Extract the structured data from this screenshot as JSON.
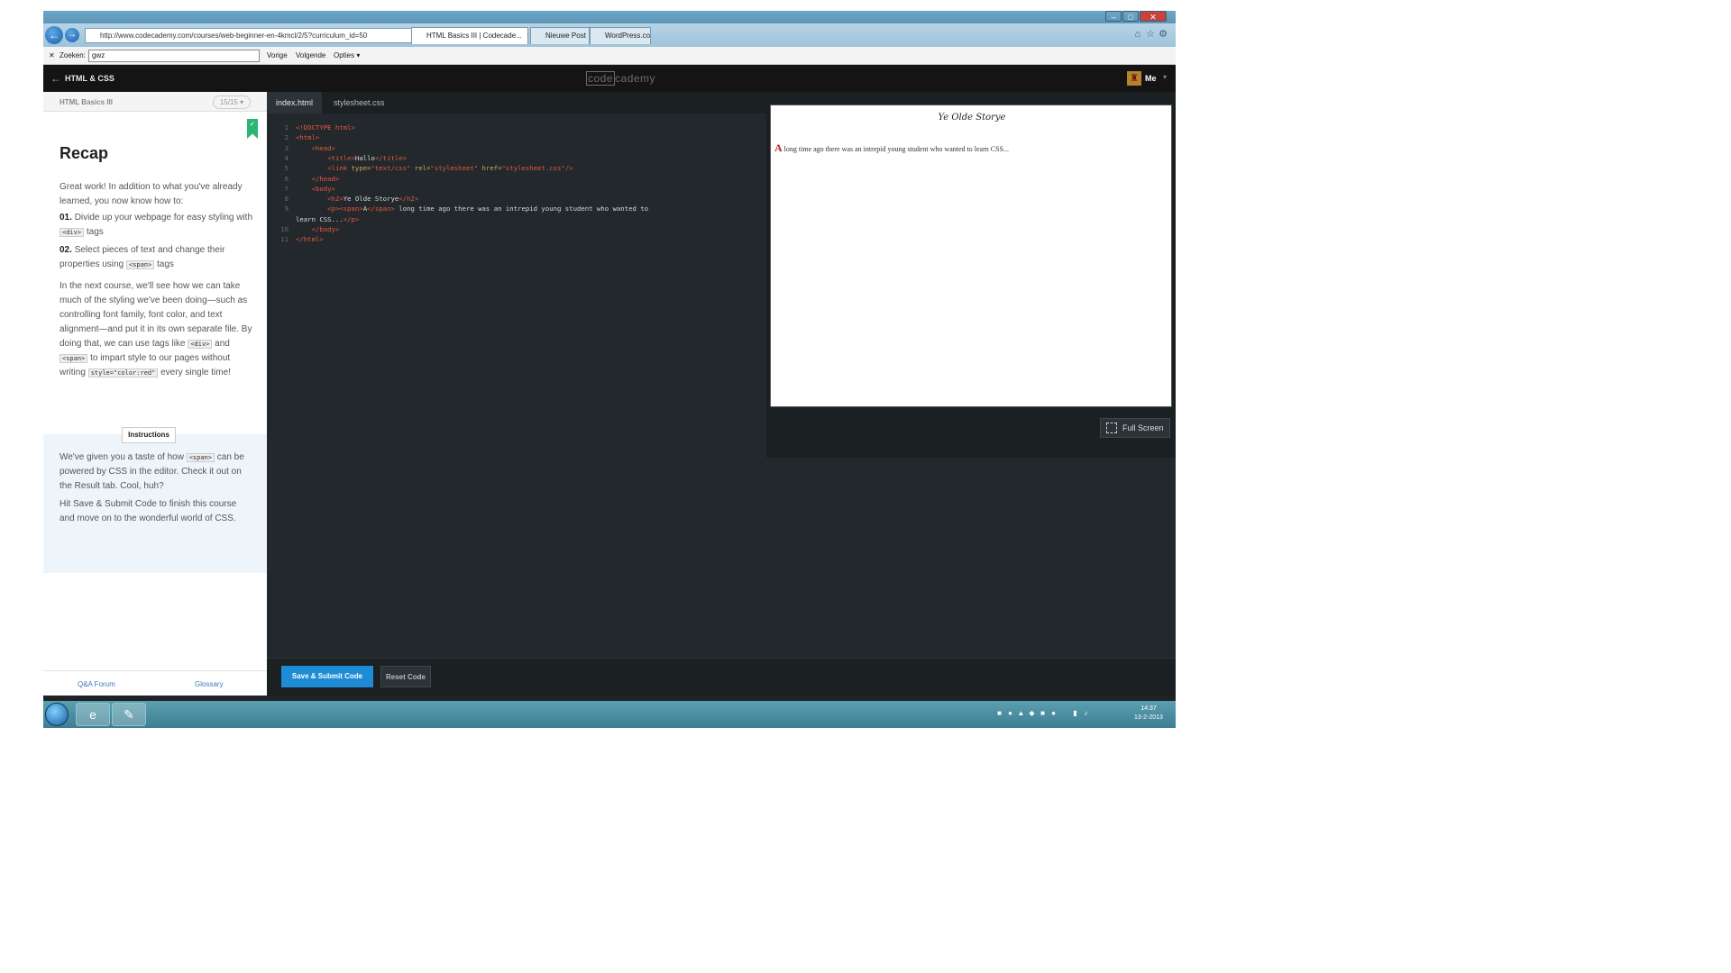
{
  "browser": {
    "window_title": "",
    "url": "http://www.codecademy.com/courses/web-beginner-en-4kmcl/2/5?curriculum_id=50",
    "tabs": [
      {
        "label": "HTML Basics III | Codecade...",
        "active": true
      },
      {
        "label": "Nieuwe Post",
        "active": false
      },
      {
        "label": "WordPress.com",
        "active": false
      }
    ],
    "find": {
      "label": "Zoeken:",
      "value": "gwz",
      "prev": "Vorige",
      "next": "Volgende",
      "options": "Opties"
    }
  },
  "header": {
    "course_title": "HTML & CSS",
    "logo_left": "code",
    "logo_right": "cademy",
    "user_label": "Me"
  },
  "lesson": {
    "name": "HTML Basics III",
    "count": "15/15",
    "title": "Recap",
    "intro": "Great work! In addition to what you've already learned, you now know how to:",
    "item1_num": "01.",
    "item1_text": "Divide up your webpage for easy styling with",
    "item1_code": "<div>",
    "item1_after": "tags",
    "item2_num": "02.",
    "item2_text": "Select pieces of text and change their properties using",
    "item2_code": "<span>",
    "item2_after": "tags",
    "para_a": "In the next course, we'll see how we can take much of the styling we've been doing—such as controlling font family, font color, and text alignment—and put it in its own separate file. By doing that, we can use tags like",
    "para_code1": "<div>",
    "para_and": "and",
    "para_code2": "<span>",
    "para_b": "to impart style to our pages without writing",
    "para_code3": "style=\"color:red\"",
    "para_c": "every single time!",
    "instructions_label": "Instructions",
    "instr_a": "We've given you a taste of how",
    "instr_code": "<span>",
    "instr_b": "can be powered by CSS in the editor. Check it out on the Result tab. Cool, huh?",
    "instr2": "Hit Save & Submit Code to finish this course and move on to the wonderful world of CSS.",
    "footer_qa": "Q&A Forum",
    "footer_glossary": "Glossary"
  },
  "editor": {
    "tabs": [
      {
        "label": "index.html",
        "active": true
      },
      {
        "label": "stylesheet.css",
        "active": false
      }
    ],
    "line_numbers": [
      "1",
      "2",
      "3",
      "4",
      "5",
      "6",
      "7",
      "8",
      "9",
      "",
      "10",
      "11"
    ],
    "save_label": "Save & Submit Code",
    "reset_label": "Reset Code"
  },
  "result": {
    "heading": "Ye Olde Storye",
    "dropcap": "A",
    "paragraph": "long time ago there was an intrepid young student who wanted to learn CSS...",
    "fullscreen_label": "Full Screen"
  },
  "taskbar": {
    "time": "14:37",
    "date": "13-2-2013"
  }
}
